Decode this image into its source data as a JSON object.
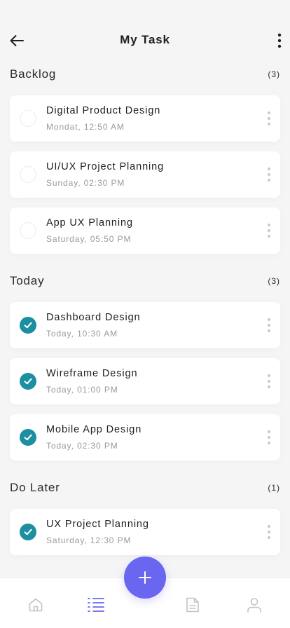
{
  "header": {
    "title": "My Task",
    "back_icon": "arrow-left-icon",
    "more_icon": "kebab-vertical-icon"
  },
  "sections": [
    {
      "title": "Backlog",
      "count": "(3)",
      "tasks": [
        {
          "title": "Digital Product Design",
          "time": "Mondat, 12:50 AM",
          "done": false
        },
        {
          "title": "UI/UX Project Planning",
          "time": "Sunday, 02:30 PM",
          "done": false
        },
        {
          "title": "App UX Planning",
          "time": "Saturday, 05:50 PM",
          "done": false
        }
      ]
    },
    {
      "title": "Today",
      "count": "(3)",
      "tasks": [
        {
          "title": "Dashboard Design",
          "time": "Today, 10:30 AM",
          "done": true
        },
        {
          "title": "Wireframe Design",
          "time": "Today, 01:00 PM",
          "done": true
        },
        {
          "title": "Mobile App Design",
          "time": "Today, 02:30 PM",
          "done": true
        }
      ]
    },
    {
      "title": "Do Later",
      "count": "(1)",
      "tasks": [
        {
          "title": "UX Project Planning",
          "time": "Saturday, 12:30 PM",
          "done": true
        }
      ]
    }
  ],
  "tabbar": {
    "tabs": [
      {
        "icon": "home-icon",
        "active": false
      },
      {
        "icon": "list-icon",
        "active": true
      },
      {
        "icon": "document-icon",
        "active": false
      },
      {
        "icon": "user-icon",
        "active": false
      }
    ],
    "fab_icon": "plus-icon"
  },
  "colors": {
    "accent": "#6a66f0",
    "check": "#1c8fa0",
    "background": "#f5f5f6"
  }
}
